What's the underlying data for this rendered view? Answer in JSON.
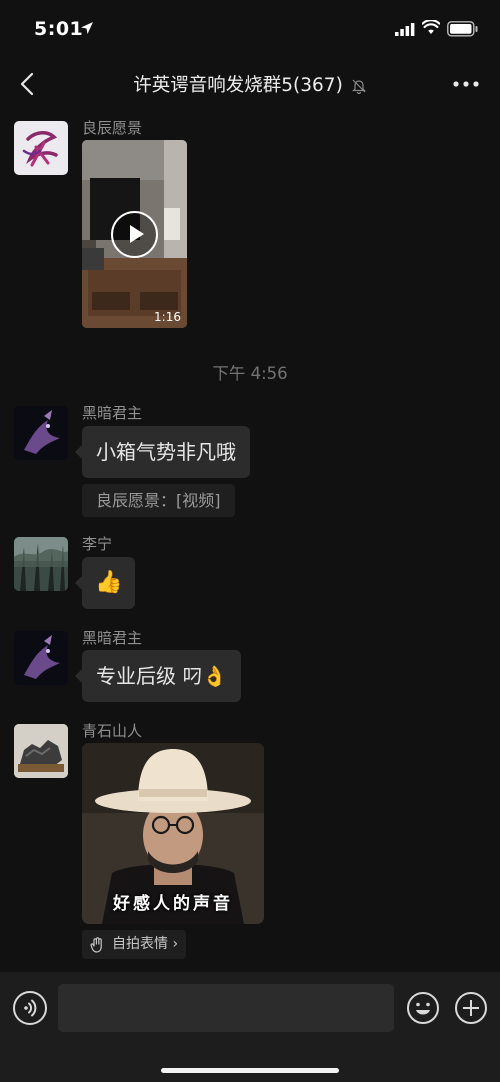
{
  "status_bar": {
    "time": "5:01"
  },
  "header": {
    "title": "许英谔音响发烧群5(367)"
  },
  "messages": [
    {
      "sender": "良辰愿景",
      "type": "video",
      "duration": "1:16"
    },
    {
      "type": "time_separator",
      "text": "下午 4:56"
    },
    {
      "sender": "黑暗君主",
      "type": "text",
      "text": "小箱气势非凡哦",
      "quote": "良辰愿景：[视频]"
    },
    {
      "sender": "李宁",
      "type": "emoji",
      "text": "👍"
    },
    {
      "sender": "黑暗君主",
      "type": "text",
      "text": "专业后级 叼👌"
    },
    {
      "sender": "青石山人",
      "type": "selfie_sticker",
      "caption": "好感人的声音",
      "link_label": "自拍表情 ›"
    }
  ],
  "input": {
    "value": "",
    "placeholder": ""
  },
  "colors": {
    "background": "#111111",
    "bubble": "#2c2c2c",
    "input_bar": "#1d1d1d"
  }
}
